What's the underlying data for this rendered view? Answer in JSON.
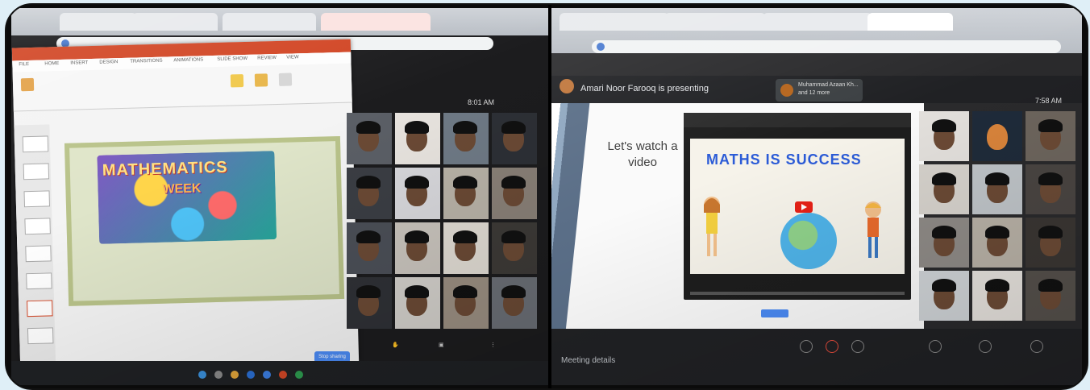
{
  "left_screen": {
    "powerpoint_ribbon_tabs": [
      "FILE",
      "HOME",
      "INSERT",
      "DESIGN",
      "TRANSITIONS",
      "ANIMATIONS",
      "SLIDE SHOW",
      "REVIEW",
      "VIEW"
    ],
    "slide_art_title": "MATHEMATICS",
    "slide_art_subtitle": "WEEK",
    "clock": "8:01 AM",
    "meet_button": "Stop sharing"
  },
  "right_screen": {
    "presenter_text": "Amari Noor Farooq is presenting",
    "participants_chip": "Muhammad Azaan Kh... and 12 more",
    "clock": "7:58 AM",
    "slide_text": "Let's watch a video",
    "video_title_text": "MATHS IS SUCCESS",
    "bottom_left": "Meeting details"
  },
  "colors": {
    "frame": "#0b0b0b",
    "background": "#dfeff7",
    "ppt_accent": "#d24726",
    "video_title": "#2b5bd7",
    "meet_blue": "#4a8af4"
  }
}
